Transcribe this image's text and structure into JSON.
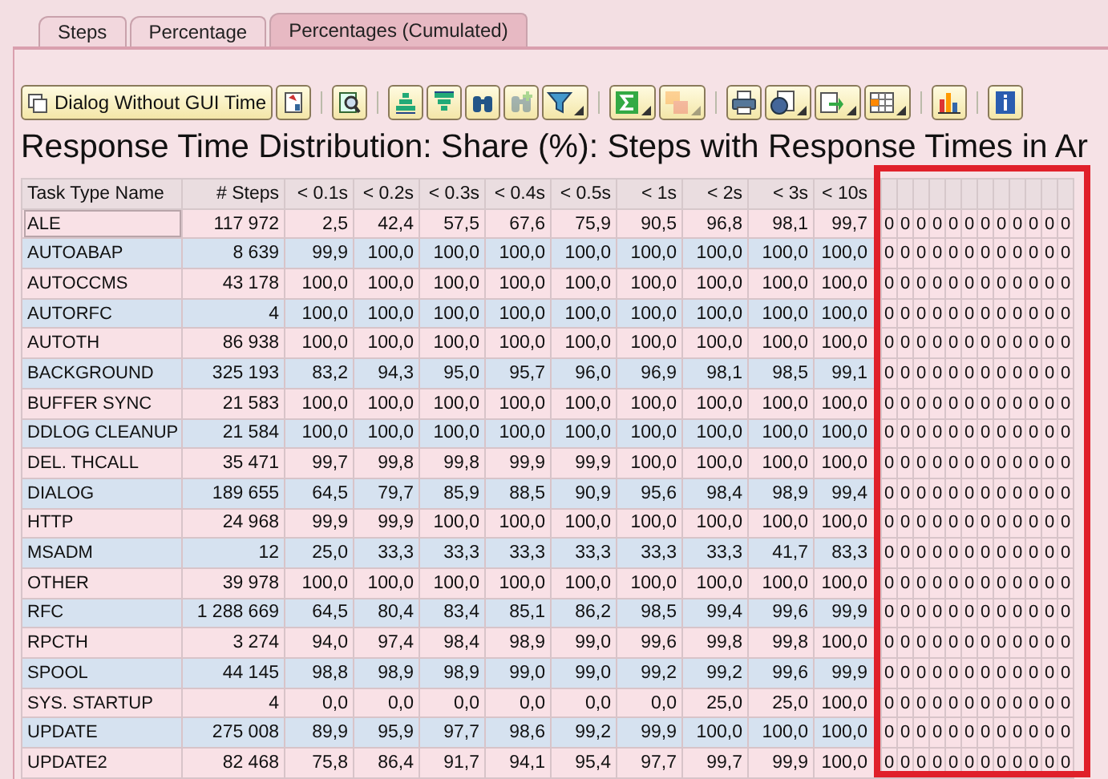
{
  "tabs": [
    {
      "label": "Steps",
      "selected": false
    },
    {
      "label": "Percentage",
      "selected": false
    },
    {
      "label": "Percentages (Cumulated)",
      "selected": true
    }
  ],
  "toolbar": [
    {
      "kind": "text",
      "label": "Dialog Without GUI Time",
      "disabled": false
    },
    {
      "kind": "icon",
      "disabled": false,
      "dropdown": false
    },
    {
      "kind": "separator"
    },
    {
      "kind": "icon",
      "disabled": false,
      "dropdown": false
    },
    {
      "kind": "separator"
    },
    {
      "kind": "icon",
      "disabled": false,
      "dropdown": false
    },
    {
      "kind": "icon",
      "disabled": false,
      "dropdown": false
    },
    {
      "kind": "icon",
      "disabled": false,
      "dropdown": false
    },
    {
      "kind": "icon",
      "disabled": true,
      "dropdown": false
    },
    {
      "kind": "icon",
      "disabled": false,
      "dropdown": true
    },
    {
      "kind": "separator"
    },
    {
      "kind": "icon",
      "disabled": false,
      "dropdown": true
    },
    {
      "kind": "icon",
      "disabled": true,
      "dropdown": true
    },
    {
      "kind": "separator"
    },
    {
      "kind": "icon",
      "disabled": false,
      "dropdown": false
    },
    {
      "kind": "icon",
      "disabled": false,
      "dropdown": true
    },
    {
      "kind": "icon",
      "disabled": false,
      "dropdown": true
    },
    {
      "kind": "icon",
      "disabled": false,
      "dropdown": true
    },
    {
      "kind": "separator"
    },
    {
      "kind": "icon",
      "disabled": false,
      "dropdown": false
    },
    {
      "kind": "separator"
    },
    {
      "kind": "icon",
      "disabled": false,
      "dropdown": false
    }
  ],
  "title": "Response Time Distribution: Share (%): Steps with Response Times in Ar",
  "highlight_frame": true,
  "table": {
    "columns": [
      "Task Type Name",
      "# Steps",
      "< 0.1s",
      "< 0.2s",
      "< 0.3s",
      "< 0.4s",
      "< 0.5s",
      "< 1s",
      "< 2s",
      "< 3s",
      "< 10s"
    ],
    "rows": [
      {
        "cells": [
          "ALE",
          "117 972",
          "2,5",
          "42,4",
          "57,5",
          "67,6",
          "75,9",
          "90,5",
          "96,8",
          "98,1",
          "99,7"
        ],
        "extra": [
          "0",
          "0",
          "0",
          "0",
          "0",
          "0",
          "0",
          "0",
          "0",
          "0",
          "0",
          "0"
        ],
        "selected": true
      },
      {
        "cells": [
          "AUTOABAP",
          "8 639",
          "99,9",
          "100,0",
          "100,0",
          "100,0",
          "100,0",
          "100,0",
          "100,0",
          "100,0",
          "100,0"
        ],
        "extra": [
          "0",
          "0",
          "0",
          "0",
          "0",
          "0",
          "0",
          "0",
          "0",
          "0",
          "0",
          "0"
        ],
        "selected": false
      },
      {
        "cells": [
          "AUTOCCMS",
          "43 178",
          "100,0",
          "100,0",
          "100,0",
          "100,0",
          "100,0",
          "100,0",
          "100,0",
          "100,0",
          "100,0"
        ],
        "extra": [
          "0",
          "0",
          "0",
          "0",
          "0",
          "0",
          "0",
          "0",
          "0",
          "0",
          "0",
          "0"
        ],
        "selected": false
      },
      {
        "cells": [
          "AUTORFC",
          "4",
          "100,0",
          "100,0",
          "100,0",
          "100,0",
          "100,0",
          "100,0",
          "100,0",
          "100,0",
          "100,0"
        ],
        "extra": [
          "0",
          "0",
          "0",
          "0",
          "0",
          "0",
          "0",
          "0",
          "0",
          "0",
          "0",
          "0"
        ],
        "selected": false
      },
      {
        "cells": [
          "AUTOTH",
          "86 938",
          "100,0",
          "100,0",
          "100,0",
          "100,0",
          "100,0",
          "100,0",
          "100,0",
          "100,0",
          "100,0"
        ],
        "extra": [
          "0",
          "0",
          "0",
          "0",
          "0",
          "0",
          "0",
          "0",
          "0",
          "0",
          "0",
          "0"
        ],
        "selected": false
      },
      {
        "cells": [
          "BACKGROUND",
          "325 193",
          "83,2",
          "94,3",
          "95,0",
          "95,7",
          "96,0",
          "96,9",
          "98,1",
          "98,5",
          "99,1"
        ],
        "extra": [
          "0",
          "0",
          "0",
          "0",
          "0",
          "0",
          "0",
          "0",
          "0",
          "0",
          "0",
          "0"
        ],
        "selected": false
      },
      {
        "cells": [
          "BUFFER SYNC",
          "21 583",
          "100,0",
          "100,0",
          "100,0",
          "100,0",
          "100,0",
          "100,0",
          "100,0",
          "100,0",
          "100,0"
        ],
        "extra": [
          "0",
          "0",
          "0",
          "0",
          "0",
          "0",
          "0",
          "0",
          "0",
          "0",
          "0",
          "0"
        ],
        "selected": false
      },
      {
        "cells": [
          "DDLOG CLEANUP",
          "21 584",
          "100,0",
          "100,0",
          "100,0",
          "100,0",
          "100,0",
          "100,0",
          "100,0",
          "100,0",
          "100,0"
        ],
        "extra": [
          "0",
          "0",
          "0",
          "0",
          "0",
          "0",
          "0",
          "0",
          "0",
          "0",
          "0",
          "0"
        ],
        "selected": false
      },
      {
        "cells": [
          "DEL. THCALL",
          "35 471",
          "99,7",
          "99,8",
          "99,8",
          "99,9",
          "99,9",
          "100,0",
          "100,0",
          "100,0",
          "100,0"
        ],
        "extra": [
          "0",
          "0",
          "0",
          "0",
          "0",
          "0",
          "0",
          "0",
          "0",
          "0",
          "0",
          "0"
        ],
        "selected": false
      },
      {
        "cells": [
          "DIALOG",
          "189 655",
          "64,5",
          "79,7",
          "85,9",
          "88,5",
          "90,9",
          "95,6",
          "98,4",
          "98,9",
          "99,4"
        ],
        "extra": [
          "0",
          "0",
          "0",
          "0",
          "0",
          "0",
          "0",
          "0",
          "0",
          "0",
          "0",
          "0"
        ],
        "selected": false
      },
      {
        "cells": [
          "HTTP",
          "24 968",
          "99,9",
          "99,9",
          "100,0",
          "100,0",
          "100,0",
          "100,0",
          "100,0",
          "100,0",
          "100,0"
        ],
        "extra": [
          "0",
          "0",
          "0",
          "0",
          "0",
          "0",
          "0",
          "0",
          "0",
          "0",
          "0",
          "0"
        ],
        "selected": false
      },
      {
        "cells": [
          "MSADM",
          "12",
          "25,0",
          "33,3",
          "33,3",
          "33,3",
          "33,3",
          "33,3",
          "33,3",
          "41,7",
          "83,3"
        ],
        "extra": [
          "0",
          "0",
          "0",
          "0",
          "0",
          "0",
          "0",
          "0",
          "0",
          "0",
          "0",
          "0"
        ],
        "selected": false
      },
      {
        "cells": [
          "OTHER",
          "39 978",
          "100,0",
          "100,0",
          "100,0",
          "100,0",
          "100,0",
          "100,0",
          "100,0",
          "100,0",
          "100,0"
        ],
        "extra": [
          "0",
          "0",
          "0",
          "0",
          "0",
          "0",
          "0",
          "0",
          "0",
          "0",
          "0",
          "0"
        ],
        "selected": false
      },
      {
        "cells": [
          "RFC",
          "1 288 669",
          "64,5",
          "80,4",
          "83,4",
          "85,1",
          "86,2",
          "98,5",
          "99,4",
          "99,6",
          "99,9"
        ],
        "extra": [
          "0",
          "0",
          "0",
          "0",
          "0",
          "0",
          "0",
          "0",
          "0",
          "0",
          "0",
          "0"
        ],
        "selected": false
      },
      {
        "cells": [
          "RPCTH",
          "3 274",
          "94,0",
          "97,4",
          "98,4",
          "98,9",
          "99,0",
          "99,6",
          "99,8",
          "99,8",
          "100,0"
        ],
        "extra": [
          "0",
          "0",
          "0",
          "0",
          "0",
          "0",
          "0",
          "0",
          "0",
          "0",
          "0",
          "0"
        ],
        "selected": false
      },
      {
        "cells": [
          "SPOOL",
          "44 145",
          "98,8",
          "98,9",
          "98,9",
          "99,0",
          "99,0",
          "99,2",
          "99,2",
          "99,6",
          "99,9"
        ],
        "extra": [
          "0",
          "0",
          "0",
          "0",
          "0",
          "0",
          "0",
          "0",
          "0",
          "0",
          "0",
          "0"
        ],
        "selected": false
      },
      {
        "cells": [
          "SYS. STARTUP",
          "4",
          "0,0",
          "0,0",
          "0,0",
          "0,0",
          "0,0",
          "0,0",
          "25,0",
          "25,0",
          "100,0"
        ],
        "extra": [
          "0",
          "0",
          "0",
          "0",
          "0",
          "0",
          "0",
          "0",
          "0",
          "0",
          "0",
          "0"
        ],
        "selected": false
      },
      {
        "cells": [
          "UPDATE",
          "275 008",
          "89,9",
          "95,9",
          "97,7",
          "98,6",
          "99,2",
          "99,9",
          "100,0",
          "100,0",
          "100,0"
        ],
        "extra": [
          "0",
          "0",
          "0",
          "0",
          "0",
          "0",
          "0",
          "0",
          "0",
          "0",
          "0",
          "0"
        ],
        "selected": false
      },
      {
        "cells": [
          "UPDATE2",
          "82 468",
          "75,8",
          "86,4",
          "91,7",
          "94,1",
          "95,4",
          "97,7",
          "99,7",
          "99,9",
          "100,0"
        ],
        "extra": [
          "0",
          "0",
          "0",
          "0",
          "0",
          "0",
          "0",
          "0",
          "0",
          "0",
          "0",
          "0"
        ],
        "selected": false
      }
    ]
  }
}
